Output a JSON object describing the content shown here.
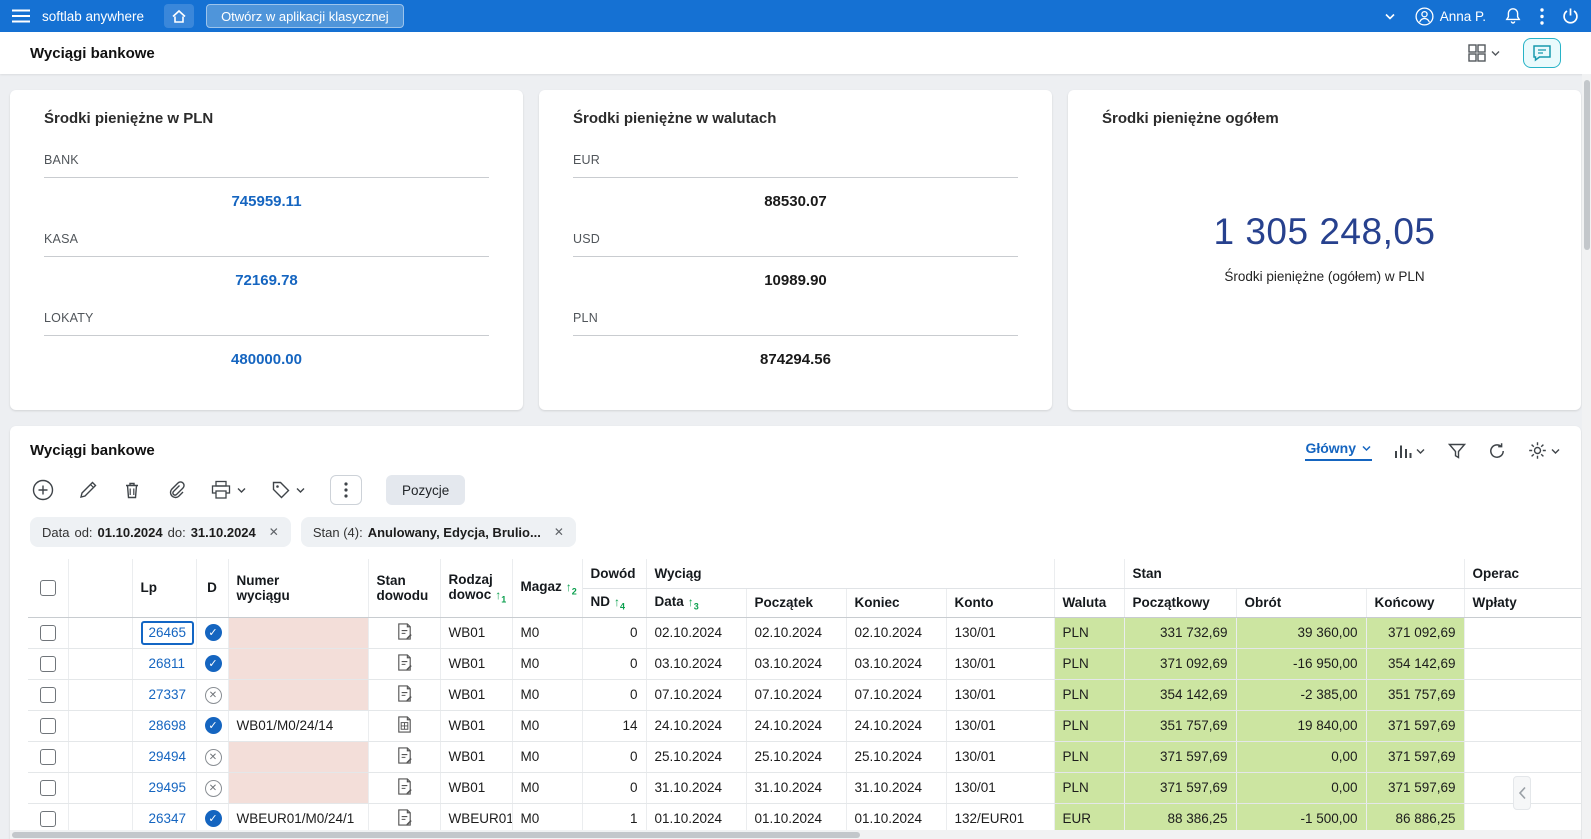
{
  "topbar": {
    "app_title": "softlab anywhere",
    "open_classic_label": "Otwórz w aplikacji klasycznej",
    "user_name": "Anna P."
  },
  "page": {
    "title": "Wyciągi bankowe"
  },
  "cards": [
    {
      "title": "Środki pieniężne w PLN",
      "items": [
        {
          "label": "BANK",
          "value": "745959.11"
        },
        {
          "label": "KASA",
          "value": "72169.78"
        },
        {
          "label": "LOKATY",
          "value": "480000.00"
        }
      ]
    },
    {
      "title": "Środki pieniężne w walutach",
      "items": [
        {
          "label": "EUR",
          "value": "88530.07"
        },
        {
          "label": "USD",
          "value": "10989.90"
        },
        {
          "label": "PLN",
          "value": "874294.56"
        }
      ]
    },
    {
      "title": "Środki pieniężne ogółem",
      "total": "1 305 248,05",
      "caption": "Środki pieniężne (ogółem) w PLN"
    }
  ],
  "grid": {
    "title": "Wyciągi bankowe",
    "view_label": "Główny",
    "pozycje_label": "Pozycje",
    "filters": {
      "date": {
        "label": "Data",
        "od_label": "od:",
        "od_value": "01.10.2024",
        "do_label": "do:",
        "do_value": "31.10.2024"
      },
      "stan": {
        "label": "Stan (4):",
        "value": "Anulowany, Edycja, Brulio..."
      }
    },
    "columns": {
      "lp": "Lp",
      "d": "D",
      "numer_l1": "Numer",
      "numer_l2": "wyciągu",
      "standow_l1": "Stan",
      "standow_l2": "dowodu",
      "rodzaj_l1": "Rodzaj",
      "rodzaj_l2": "dowoc",
      "magaz": "Magaz",
      "dowod_group": "Dowód",
      "nd": "ND",
      "wyciag_group": "Wyciąg",
      "data": "Data",
      "poczatek": "Początek",
      "koniec": "Koniec",
      "konto": "Konto",
      "waluta": "Waluta",
      "stan_group": "Stan",
      "poczatkowy": "Początkowy",
      "obrot": "Obrót",
      "koncowy": "Końcowy",
      "operac_group": "Operac",
      "wplaty": "Wpłaty"
    },
    "sort_badges": {
      "rodzaj": "1",
      "magaz": "2",
      "data": "3",
      "nd": "4"
    },
    "rows": [
      {
        "lp": "26465",
        "d": "check",
        "numer": "",
        "doc_icon": "document-edit",
        "rodzaj": "WB01",
        "magaz": "M0",
        "nd": "0",
        "data": "02.10.2024",
        "poczatek": "02.10.2024",
        "koniec": "02.10.2024",
        "konto": "130/01",
        "waluta": "PLN",
        "poczatkowy": "331 732,69",
        "obrot": "39 360,00",
        "koncowy": "371 092,69",
        "selected": true
      },
      {
        "lp": "26811",
        "d": "check",
        "numer": "",
        "doc_icon": "document-edit",
        "rodzaj": "WB01",
        "magaz": "M0",
        "nd": "0",
        "data": "03.10.2024",
        "poczatek": "03.10.2024",
        "koniec": "03.10.2024",
        "konto": "130/01",
        "waluta": "PLN",
        "poczatkowy": "371 092,69",
        "obrot": "-16 950,00",
        "koncowy": "354 142,69"
      },
      {
        "lp": "27337",
        "d": "cross",
        "numer": "",
        "doc_icon": "document-edit",
        "rodzaj": "WB01",
        "magaz": "M0",
        "nd": "0",
        "data": "07.10.2024",
        "poczatek": "07.10.2024",
        "koniec": "07.10.2024",
        "konto": "130/01",
        "waluta": "PLN",
        "poczatkowy": "354 142,69",
        "obrot": "-2 385,00",
        "koncowy": "351 757,69"
      },
      {
        "lp": "28698",
        "d": "check",
        "numer": "WB01/M0/24/14",
        "doc_icon": "document-grid",
        "rodzaj": "WB01",
        "magaz": "M0",
        "nd": "14",
        "data": "24.10.2024",
        "poczatek": "24.10.2024",
        "koniec": "24.10.2024",
        "konto": "130/01",
        "waluta": "PLN",
        "poczatkowy": "351 757,69",
        "obrot": "19 840,00",
        "koncowy": "371 597,69"
      },
      {
        "lp": "29494",
        "d": "cross",
        "numer": "",
        "doc_icon": "document-edit",
        "rodzaj": "WB01",
        "magaz": "M0",
        "nd": "0",
        "data": "25.10.2024",
        "poczatek": "25.10.2024",
        "koniec": "25.10.2024",
        "konto": "130/01",
        "waluta": "PLN",
        "poczatkowy": "371 597,69",
        "obrot": "0,00",
        "koncowy": "371 597,69"
      },
      {
        "lp": "29495",
        "d": "cross",
        "numer": "",
        "doc_icon": "document-edit",
        "rodzaj": "WB01",
        "magaz": "M0",
        "nd": "0",
        "data": "31.10.2024",
        "poczatek": "31.10.2024",
        "koniec": "31.10.2024",
        "konto": "130/01",
        "waluta": "PLN",
        "poczatkowy": "371 597,69",
        "obrot": "0,00",
        "koncowy": "371 597,69"
      },
      {
        "lp": "26347",
        "d": "check",
        "numer": "WBEUR01/M0/24/1",
        "doc_icon": "document-edit",
        "rodzaj": "WBEUR01",
        "magaz": "M0",
        "nd": "1",
        "data": "01.10.2024",
        "poczatek": "01.10.2024",
        "koniec": "01.10.2024",
        "konto": "132/EUR01",
        "waluta": "EUR",
        "poczatkowy": "88 386,25",
        "obrot": "-1 500,00",
        "koncowy": "86 886,25"
      }
    ]
  }
}
